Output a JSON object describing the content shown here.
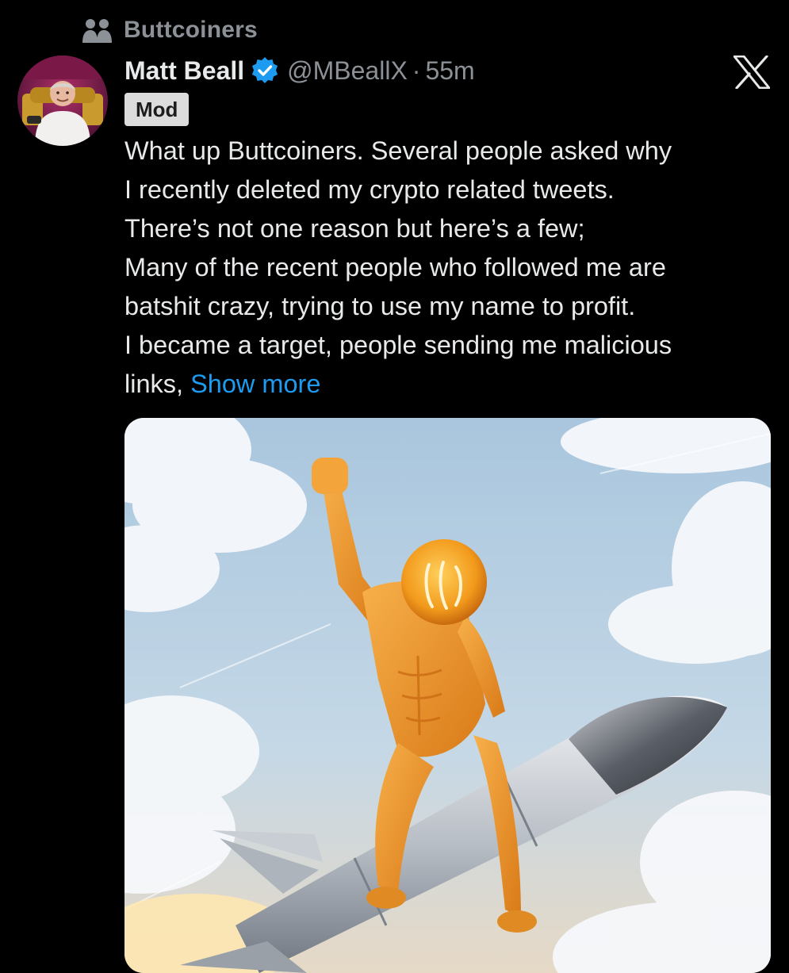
{
  "community": {
    "name": "Buttcoiners",
    "icon": "community-people-icon"
  },
  "post": {
    "author": {
      "display_name": "Matt Beall",
      "handle": "@MBeallX",
      "verified_icon": "verified-badge-icon",
      "avatar": "avatar"
    },
    "separator": "·",
    "time": "55m",
    "badge": "Mod",
    "text_lines": [
      "What up Buttcoiners. Several people asked why",
      "I recently deleted my crypto related tweets.",
      "There’s not one reason but here’s a few;",
      "Many of the recent people who followed me are",
      "batshit crazy, trying to use my name to profit.",
      "I became a target, people sending me malicious",
      "links, "
    ],
    "show_more": "Show more",
    "source_icon": "x-logo-icon",
    "media": "post-image"
  },
  "colors": {
    "background": "#000000",
    "text": "#e7e9ea",
    "secondary_text": "#8b9197",
    "link": "#1d9bf0",
    "verified": "#1d9bf0",
    "badge_bg": "#dcdcdc"
  }
}
